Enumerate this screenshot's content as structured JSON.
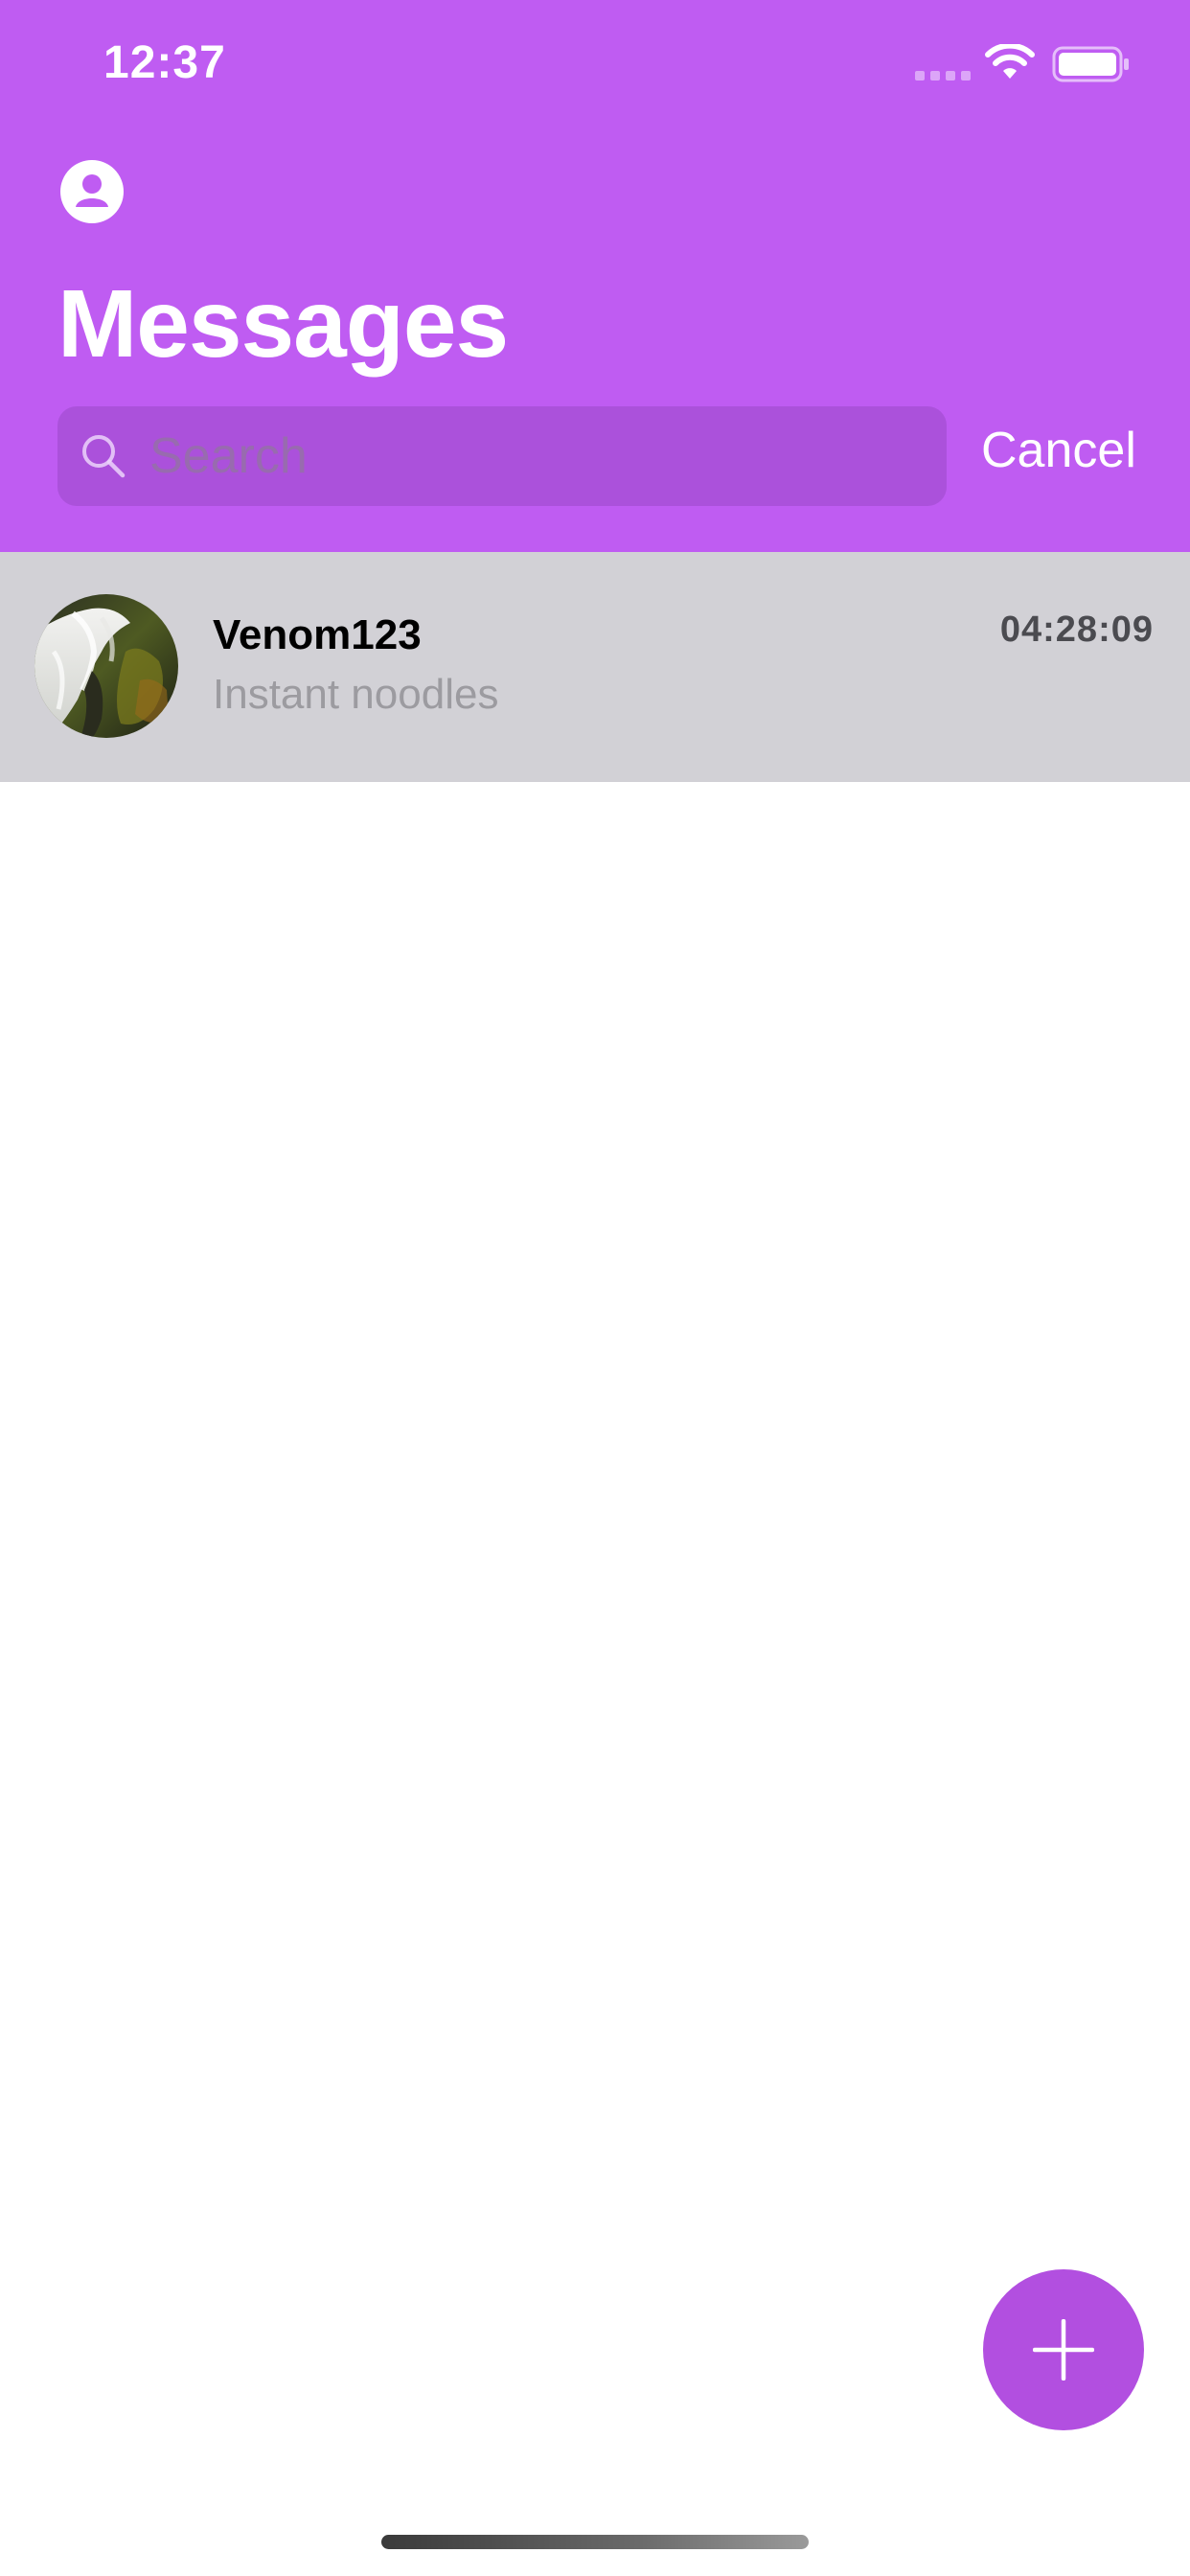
{
  "status_bar": {
    "time": "12:37",
    "icons": [
      "signal-dots-icon",
      "wifi-icon",
      "battery-icon"
    ]
  },
  "header": {
    "profile_icon": "person-circle-icon",
    "title": "Messages"
  },
  "search": {
    "placeholder": "Search",
    "value": "",
    "icon": "search-icon",
    "cancel_label": "Cancel"
  },
  "conversations": [
    {
      "name": "Venom123",
      "preview": "Instant noodles",
      "time": "04:28:09",
      "avatar": "waterfall-photo"
    }
  ],
  "fab": {
    "icon": "plus-icon"
  },
  "colors": {
    "header_bg": "#bf5cf2",
    "fab_bg": "#b24fe0",
    "row_selected_bg": "#d2d1d6"
  }
}
